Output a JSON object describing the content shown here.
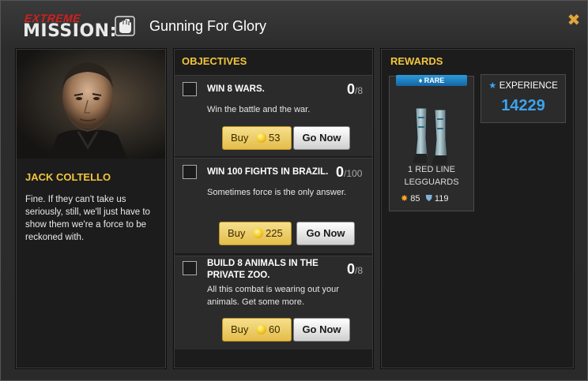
{
  "header": {
    "label_top": "EXTREME",
    "label_bottom": "MISSION:",
    "title": "Gunning For Glory",
    "close_icon": "close-icon"
  },
  "character": {
    "name": "JACK COLTELLO",
    "quote": "Fine. If they can't take us seriously, still, we'll just have to show them we're a force to be reckoned with."
  },
  "objectives": {
    "heading": "OBJECTIVES",
    "items": [
      {
        "title": "WIN 8 WARS.",
        "progress": "0",
        "total": "/8",
        "description": "Win the battle and the war.",
        "buy_label": "Buy",
        "buy_cost": "53",
        "go_label": "Go Now"
      },
      {
        "title": "WIN 100 FIGHTS IN BRAZIL.",
        "progress": "0",
        "total": "/100",
        "description": "Sometimes force is the only answer.",
        "buy_label": "Buy",
        "buy_cost": "225",
        "go_label": "Go Now"
      },
      {
        "title": "BUILD 8 ANIMALS IN THE PRIVATE ZOO.",
        "progress": "0",
        "total": "/8",
        "description": "All this combat is wearing out your animals. Get some more.",
        "buy_label": "Buy",
        "buy_cost": "60",
        "go_label": "Go Now"
      }
    ]
  },
  "rewards": {
    "heading": "REWARDS",
    "item": {
      "rarity": "♦ RARE",
      "name_line1": "1 RED LINE",
      "name_line2": "LEGGUARDS",
      "attack": "85",
      "defense": "119"
    },
    "experience": {
      "label": "EXPERIENCE",
      "value": "14229"
    }
  },
  "colors": {
    "accent": "#f2c53d",
    "extreme_red": "#d41f1f",
    "experience_blue": "#3ca3ec",
    "rare_blue": "#2e9ad9"
  }
}
